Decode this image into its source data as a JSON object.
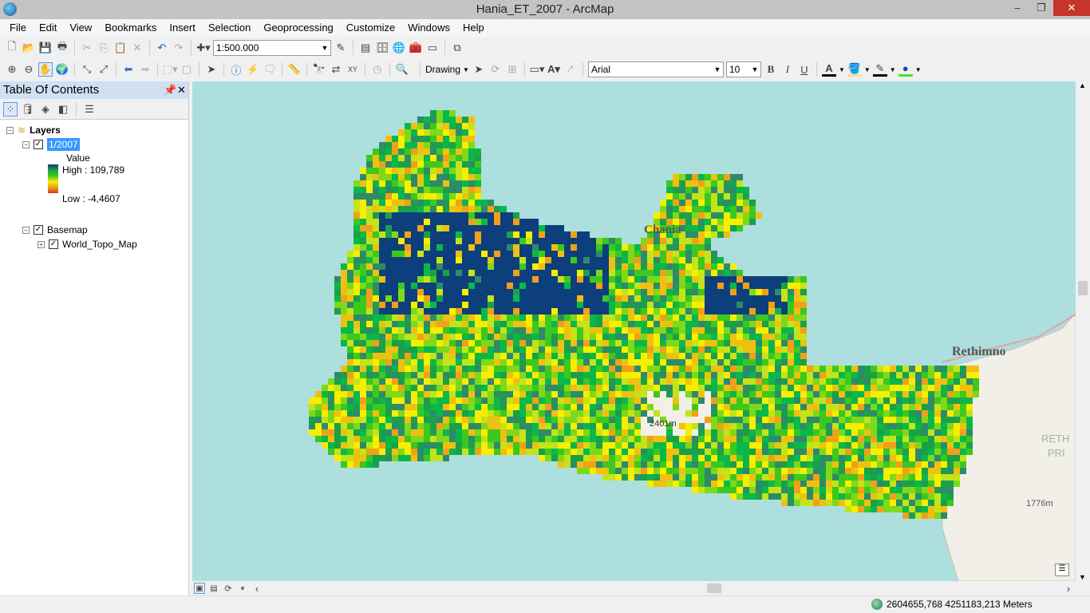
{
  "window": {
    "title": "Hania_ET_2007 - ArcMap",
    "minimize": "–",
    "maximize": "❐",
    "close": "✕"
  },
  "menu": [
    "File",
    "Edit",
    "View",
    "Bookmarks",
    "Insert",
    "Selection",
    "Geoprocessing",
    "Customize",
    "Windows",
    "Help"
  ],
  "toolbar": {
    "scale": "1:500.000",
    "drawing_label": "Drawing",
    "font": "Arial",
    "font_size": "10",
    "bold": "B",
    "italic": "I",
    "underline": "U",
    "font_color": "A"
  },
  "toc": {
    "title": "Table Of Contents",
    "pin": "ᚹ",
    "close": "✕",
    "root": "Layers",
    "layer": {
      "name": "1/2007",
      "legend_field": "Value",
      "high": "High : 109,789",
      "low": "Low : -4,4607",
      "ramp": [
        "#0c3f7c",
        "#1aa04a",
        "#3cc81e",
        "#f7ee00",
        "#f0a01a",
        "#d0401a"
      ]
    },
    "basemap": {
      "name": "Basemap",
      "child": "World_Topo_Map"
    }
  },
  "map": {
    "labels": {
      "chania": "Chania",
      "rethimno": "Rethimno",
      "peak1": "2401m",
      "peak2": "1776m",
      "reth": "RETH",
      "pri": "PRI"
    },
    "sea_color": "#acdfdd",
    "land_color": "#f2efe9"
  },
  "status": {
    "coordinates": "2604655,768  4251183,213 Meters"
  }
}
